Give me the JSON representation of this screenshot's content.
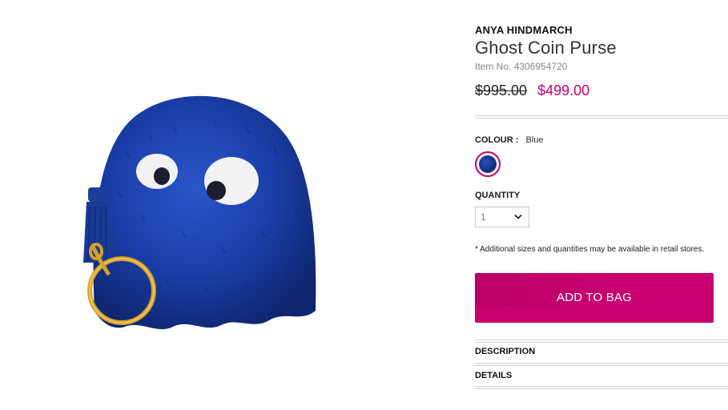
{
  "product": {
    "brand": "ANYA HINDMARCH",
    "title": "Ghost Coin Purse",
    "item_no_label": "Item No.",
    "item_no": "4306954720",
    "price_original": "$995.00",
    "price_sale": "$499.00",
    "image_alt": "product-photo"
  },
  "colour": {
    "label": "COLOUR :",
    "value": "Blue",
    "swatch_color": "#12307f"
  },
  "quantity": {
    "label": "QUANTITY",
    "value": "1"
  },
  "note": "* Additional sizes and quantities may be available in retail stores.",
  "add_to_bag": "ADD TO BAG",
  "accordion": {
    "description": "DESCRIPTION",
    "details": "DETAILS"
  },
  "colors": {
    "accent": "#c8006f",
    "sale_price": "#c3006f",
    "purse_blue": "#1a3fa8"
  },
  "icons": {
    "quantity_chevron": "chevron-down-icon"
  }
}
